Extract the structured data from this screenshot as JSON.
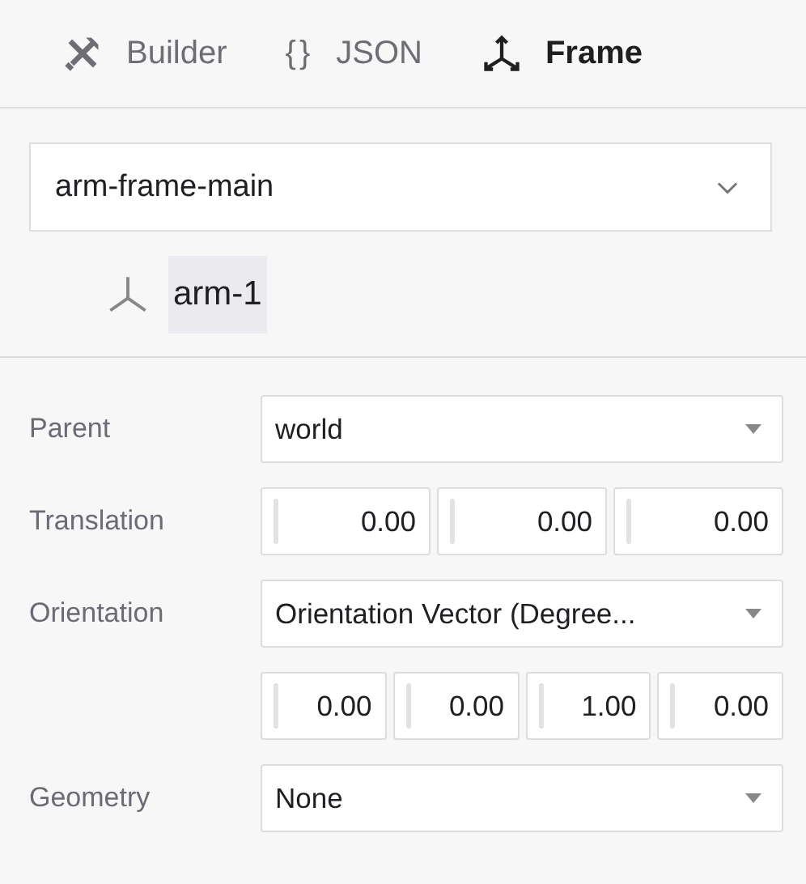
{
  "tabs": [
    {
      "label": "Builder",
      "kind": "tools",
      "selected": false
    },
    {
      "label": "JSON",
      "kind": "braces",
      "icon_text": "{}",
      "selected": false
    },
    {
      "label": "Frame",
      "kind": "axes",
      "selected": true
    }
  ],
  "frame_select": {
    "value": "arm-frame-main"
  },
  "tree": [
    {
      "label": "arm-1",
      "selected": true
    }
  ],
  "fields": [
    {
      "label": "Parent",
      "kind": "select",
      "value": "world"
    },
    {
      "label": "Translation",
      "kind": "numbers",
      "values": [
        "0.00",
        "0.00",
        "0.00"
      ]
    },
    {
      "label": "Orientation",
      "kind": "select",
      "value": "Orientation Vector (Degree..."
    },
    {
      "kind": "numbers",
      "values": [
        "0.00",
        "0.00",
        "1.00",
        "0.00"
      ]
    },
    {
      "label": "Geometry",
      "kind": "select",
      "value": "None"
    }
  ]
}
